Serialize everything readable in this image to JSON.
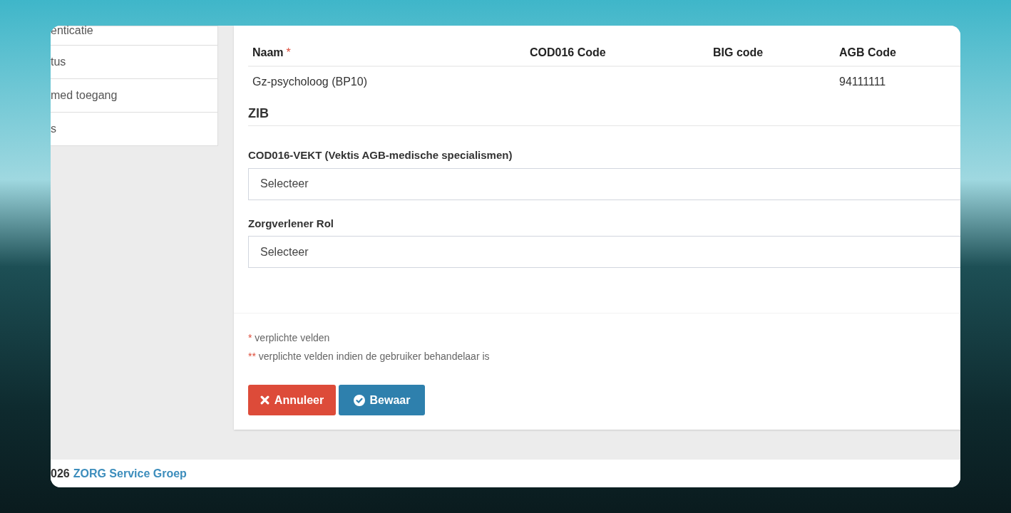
{
  "sidebar": {
    "items": [
      {
        "label": "enticatie"
      },
      {
        "label": "tus"
      },
      {
        "label": "med toegang"
      },
      {
        "label": "s"
      }
    ]
  },
  "table": {
    "columns": [
      {
        "label": "Naam",
        "required": true
      },
      {
        "label": "COD016 Code",
        "required": false
      },
      {
        "label": "BIG code",
        "required": false
      },
      {
        "label": "AGB Code",
        "required": false
      }
    ],
    "rows": [
      [
        "Gz-psycholoog (BP10)",
        "",
        "",
        "94111111"
      ]
    ]
  },
  "section": {
    "title": "ZIB"
  },
  "fields": [
    {
      "label": "COD016-VEKT (Vektis AGB-medische specialismen)",
      "placeholder": "Selecteer"
    },
    {
      "label": "Zorgverlener Rol",
      "placeholder": "Selecteer"
    }
  ],
  "notes": [
    {
      "marker": "*",
      "text": "verplichte velden"
    },
    {
      "marker": "**",
      "text": "verplichte velden indien de gebruiker behandelaar is"
    }
  ],
  "buttons": [
    {
      "kind": "cancel",
      "label": "Annuleer"
    },
    {
      "kind": "save",
      "label": "Bewaar"
    }
  ],
  "footer": {
    "year": "026",
    "company": "ZORG Service Groep"
  }
}
